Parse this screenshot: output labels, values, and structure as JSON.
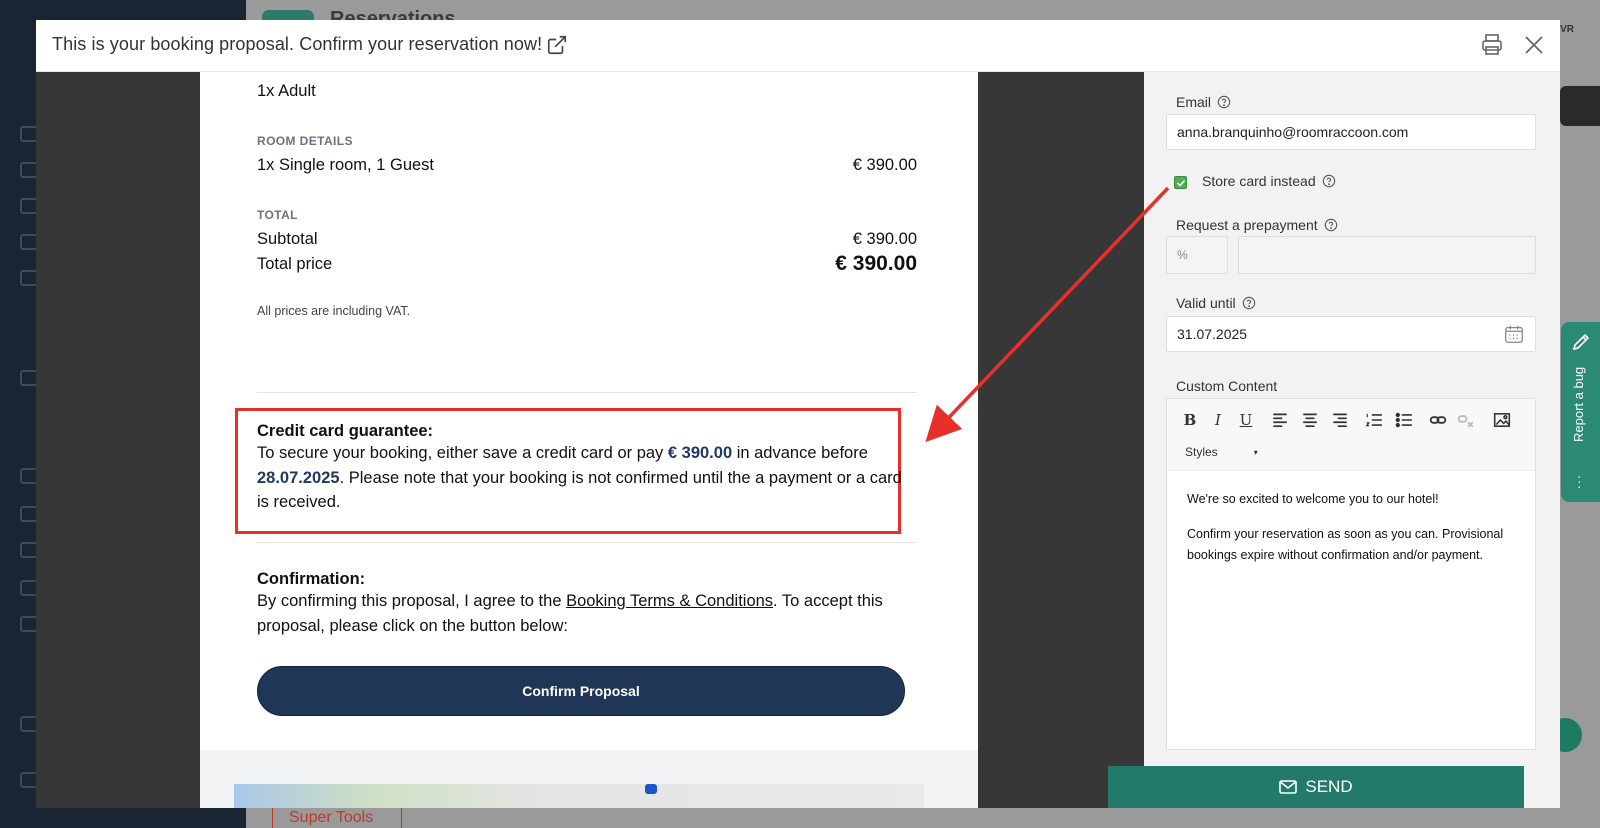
{
  "background": {
    "header_title": "Reservations",
    "super_tools": "Super Tools",
    "avatar_initials": "VR"
  },
  "modal": {
    "title": "This is your booking proposal. Confirm your reservation now!"
  },
  "proposal": {
    "guests": "1x Adult",
    "room_details_label": "ROOM DETAILS",
    "room_line": "1x Single room, 1 Guest",
    "room_price": "€ 390.00",
    "total_label": "TOTAL",
    "subtotal_label": "Subtotal",
    "subtotal_value": "€ 390.00",
    "total_price_label": "Total price",
    "total_price_value": "€ 390.00",
    "vat_note": "All prices are including VAT.",
    "guarantee": {
      "title": "Credit card guarantee:",
      "text_1": "To secure your booking, either save a credit card or pay ",
      "amount": "€ 390.00",
      "text_2": " in advance before ",
      "date": "28.07.2025",
      "text_3": ". Please note that your booking is not confirmed until the a payment or a card is received."
    },
    "confirmation": {
      "title": "Confirmation:",
      "text_1": "By confirming this proposal, I agree to the ",
      "link": "Booking Terms & Conditions",
      "text_2": ". To accept this proposal, please click on the button below:"
    },
    "confirm_button": "Confirm Proposal"
  },
  "form": {
    "email_label": "Email",
    "email_value": "anna.branquinho@roomraccoon.com",
    "store_card_label": "Store card instead",
    "store_card_checked": true,
    "prepayment_label": "Request a prepayment",
    "prepayment_unit": "%",
    "prepayment_value": "",
    "valid_until_label": "Valid until",
    "valid_until_value": "31.07.2025",
    "custom_content_label": "Custom Content",
    "styles_label": "Styles",
    "editor_p1": "We're so excited to welcome you to our hotel!",
    "editor_p2": "Confirm your reservation as soon as you can. Provisional bookings expire without confirmation and/or payment.",
    "send_label": "SEND"
  },
  "report_bug": {
    "label": "Report a bug"
  },
  "colors": {
    "accent_green": "#237a6a",
    "highlight_red": "#e8302a",
    "button_navy": "#1f3656"
  }
}
